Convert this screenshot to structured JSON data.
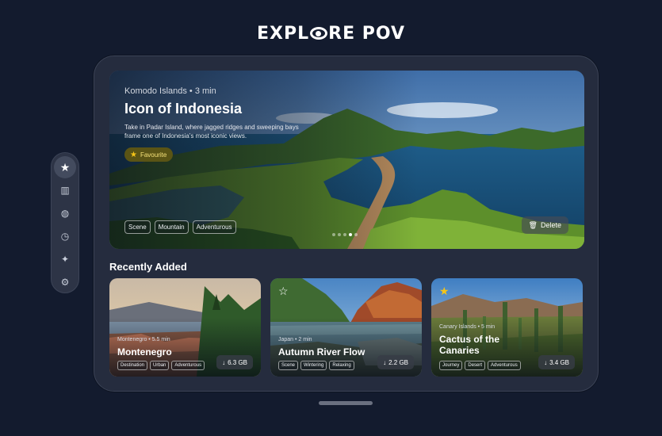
{
  "logo": {
    "left": "EXPL",
    "right": "RE POV"
  },
  "hero": {
    "meta": "Komodo Islands • 3 min",
    "title": "Icon of Indonesia",
    "description": "Take in Padar Island, where jagged ridges and sweeping bays frame one of Indonesia's most iconic views.",
    "favourite_label": "Favourite",
    "tags": [
      "Scene",
      "Mountain",
      "Adventurous"
    ],
    "delete_label": "Delete",
    "page_count": 5,
    "active_page": 4
  },
  "section": {
    "title": "Recently Added"
  },
  "cards": [
    {
      "meta": "Montenegro • 5.5 min",
      "title": "Montenegro",
      "tags": [
        "Destination",
        "Urban",
        "Adventurous"
      ],
      "size": "6.3 GB",
      "favourited": false,
      "star_visible": false
    },
    {
      "meta": "Japan • 2 min",
      "title": "Autumn River Flow",
      "tags": [
        "Scene",
        "Wintering",
        "Relaxing"
      ],
      "size": "2.2 GB",
      "favourited": false,
      "star_visible": true
    },
    {
      "meta": "Canary Islands • 5 min",
      "title": "Cactus of the Canaries",
      "tags": [
        "Journey",
        "Desert",
        "Adventurous"
      ],
      "size": "3.4 GB",
      "favourited": true,
      "star_visible": true
    }
  ],
  "sidebar": {
    "items": [
      {
        "icon": "star-icon",
        "glyph": "★",
        "active": true
      },
      {
        "icon": "library-icon",
        "glyph": "▥",
        "active": false
      },
      {
        "icon": "globe-icon",
        "glyph": "◍",
        "active": false
      },
      {
        "icon": "timer-icon",
        "glyph": "◷",
        "active": false
      },
      {
        "icon": "sparkle-icon",
        "glyph": "✦",
        "active": false
      },
      {
        "icon": "gear-icon",
        "glyph": "⚙",
        "active": false
      }
    ]
  },
  "colors": {
    "background": "#131b2e",
    "device": "#252c3e",
    "favourite_star": "#f5c518"
  }
}
